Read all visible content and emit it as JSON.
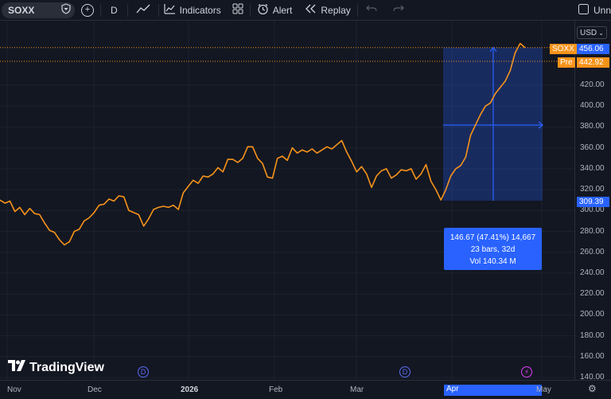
{
  "toolbar": {
    "symbol": "SOXX",
    "interval": "D",
    "indicators": "Indicators",
    "alert": "Alert",
    "replay": "Replay",
    "unnamed": "Unn"
  },
  "price_axis": {
    "currency": "USD",
    "ticks": [
      "420.00",
      "400.00",
      "380.00",
      "360.00",
      "340.00",
      "320.00",
      "300.00",
      "280.00",
      "260.00",
      "240.00",
      "220.00",
      "200.00",
      "180.00",
      "160.00",
      "140.00"
    ],
    "soxx_label": "SOXX",
    "soxx_price": "456.06",
    "pre_label": "Pre",
    "pre_price": "442.92",
    "measure_start_price": "309.39"
  },
  "time_axis": {
    "labels": [
      "Nov",
      "Dec",
      "2026",
      "Feb",
      "Mar",
      "Apr",
      "May"
    ]
  },
  "measure": {
    "line1": "146.67 (47.41%) 14,667",
    "line2": "23 bars, 32d",
    "line3": "Vol 140.34 M"
  },
  "branding": "TradingView",
  "events": {
    "dividend": "D",
    "earnings_icon": "bolt-icon"
  },
  "colors": {
    "line": "#f7931a",
    "measure": "#2962ff",
    "background": "#131722"
  },
  "chart_data": {
    "type": "line",
    "y": [
      310,
      307,
      309,
      299,
      303,
      296,
      302,
      297,
      296,
      288,
      281,
      279,
      272,
      267,
      270,
      280,
      282,
      290,
      293,
      298,
      305,
      306,
      311,
      309,
      314,
      313,
      300,
      298,
      296,
      285,
      292,
      301,
      303,
      304,
      303,
      305,
      301,
      317,
      323,
      329,
      326,
      333,
      332,
      335,
      341,
      337,
      349,
      349,
      346,
      350,
      361,
      361,
      350,
      345,
      332,
      331,
      350,
      352,
      348,
      360,
      355,
      358,
      356,
      359,
      355,
      358,
      361,
      359,
      363,
      367,
      356,
      347,
      337,
      342,
      335,
      322,
      333,
      338,
      340,
      331,
      334,
      339,
      338,
      340,
      330,
      335,
      344,
      328,
      320,
      310,
      320,
      333,
      340,
      343,
      351,
      372,
      382,
      392,
      400,
      403,
      412,
      418,
      424,
      434,
      451,
      460,
      456
    ],
    "ylim": [
      140,
      470
    ]
  }
}
